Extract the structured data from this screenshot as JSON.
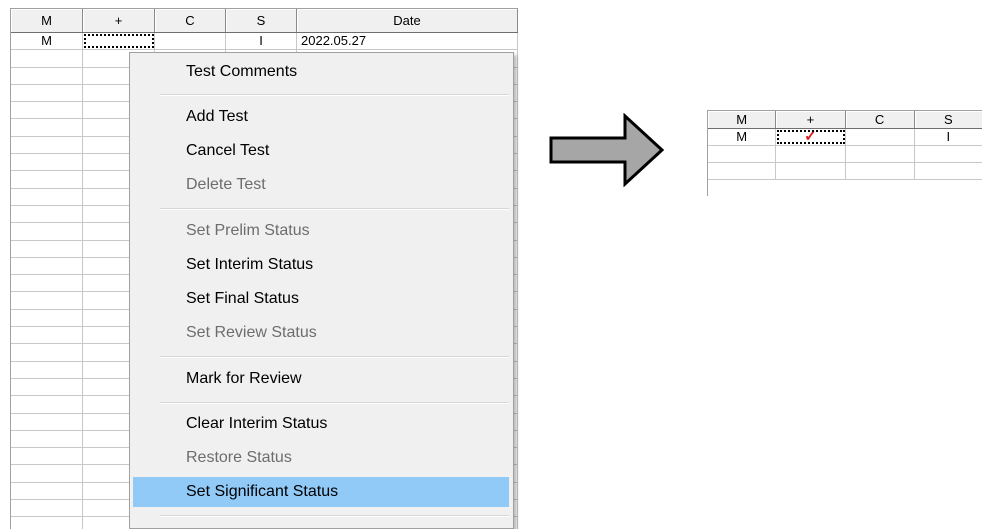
{
  "left_grid": {
    "headers": [
      "M",
      "+",
      "C",
      "S",
      "Date"
    ],
    "first_row": {
      "m": "M",
      "plus": "",
      "c": "",
      "s": "I",
      "date": "2022.05.27"
    }
  },
  "context_menu": {
    "items": [
      {
        "label": "Test Comments",
        "enabled": true
      },
      {
        "label": "Add Test",
        "enabled": true
      },
      {
        "label": "Cancel Test",
        "enabled": true
      },
      {
        "label": "Delete Test",
        "enabled": false
      },
      {
        "label": "Set Prelim Status",
        "enabled": false
      },
      {
        "label": "Set Interim Status",
        "enabled": true
      },
      {
        "label": "Set Final Status",
        "enabled": true
      },
      {
        "label": "Set Review Status",
        "enabled": false
      },
      {
        "label": "Mark for Review",
        "enabled": true
      },
      {
        "label": "Clear Interim Status",
        "enabled": true
      },
      {
        "label": "Restore Status",
        "enabled": false
      },
      {
        "label": "Set Significant Status",
        "enabled": true,
        "highlighted": true
      }
    ],
    "highlight_color": "#91c9f7"
  },
  "arrow": {
    "icon": "right-arrow-icon",
    "fill": "#a6a6a6"
  },
  "right_grid": {
    "headers": [
      "M",
      "+",
      "C",
      "S"
    ],
    "first_row": {
      "m": "M",
      "plus_icon": "checkmark-icon",
      "check_glyph": "✓",
      "check_color": "#e21b1b",
      "c": "",
      "s": "I"
    }
  }
}
